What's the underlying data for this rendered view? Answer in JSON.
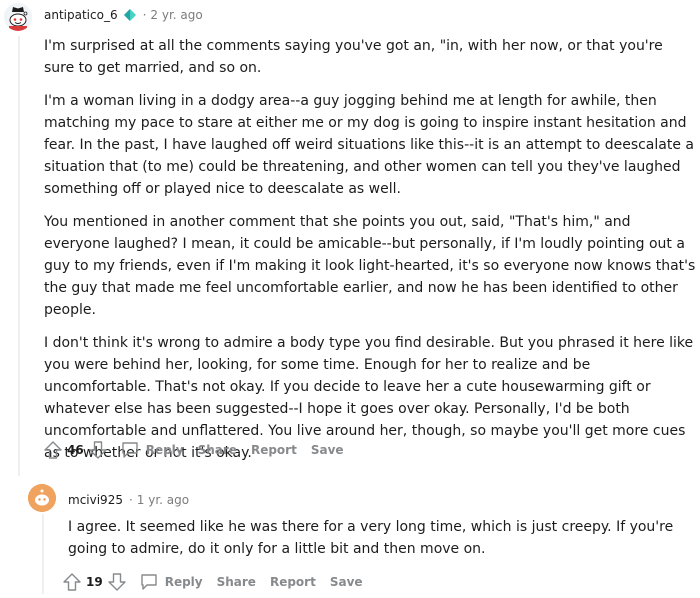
{
  "comments": [
    {
      "username": "antipatico_6",
      "time": "2 yr. ago",
      "paragraphs": [
        "I'm surprised at all the comments saying you've got an, \"in, with her now, or that you're sure to get married, and so on.",
        "I'm a woman living in a dodgy area--a guy jogging behind me at length for awhile, then matching my pace to stare at either me or my dog is going to inspire instant hesitation and fear. In the past, I have laughed off weird situations like this--it is an attempt to deescalate a situation that (to me) could be threatening, and other women can tell you they've laughed something off or played nice to deescalate as well.",
        "You mentioned in another comment that she points you out, said, \"That's him,\" and everyone laughed? I mean, it could be amicable--but personally, if I'm loudly pointing out a guy to my friends, even if I'm making it look light-hearted, it's so everyone now knows that's the guy that made me feel uncomfortable earlier, and now he has been identified to other people.",
        "I don't think it's wrong to admire a body type you find desirable. But you phrased it here like you were behind her, looking, for some time. Enough for her to realize and be uncomfortable. That's not okay. If you decide to leave her a cute housewarming gift or whatever else has been suggested--I hope it goes over okay. Personally, I'd be both uncomfortable and unflattered. You live around her, though, so maybe you'll get more cues as to whether or not it's okay."
      ],
      "votes": "46",
      "actions": {
        "reply": "Reply",
        "share": "Share",
        "report": "Report",
        "save": "Save"
      }
    },
    {
      "username": "mcivi925",
      "time": "1 yr. ago",
      "paragraphs": [
        "I agree. It seemed like he was there for a very long time, which is just creepy. If you're going to admire, do it only for a little bit and then move on."
      ],
      "votes": "19",
      "actions": {
        "reply": "Reply",
        "share": "Share",
        "report": "Report",
        "save": "Save"
      }
    }
  ],
  "colors": {
    "meta_gray": "#7c7c7c",
    "action_gray": "#878a8c",
    "thread_line": "#edeff1",
    "flair_teal": "#46d1c6",
    "avatar2_orange": "#e8944a"
  },
  "icons": [
    "snoo-avatar-icon",
    "flair-icon",
    "upvote-icon",
    "downvote-icon",
    "reply-icon"
  ]
}
